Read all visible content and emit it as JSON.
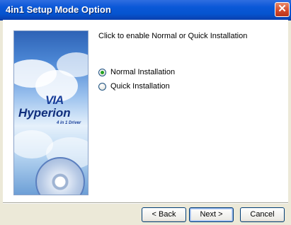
{
  "window": {
    "title": "4in1 Setup Mode Option",
    "close_glyph": "✕"
  },
  "banner": {
    "brand_mark": "VIA",
    "product_name": "Hyperion",
    "product_sub": "4 in 1 Driver"
  },
  "content": {
    "heading": "Click to enable Normal or Quick Installation",
    "options": [
      {
        "label": "Normal Installation",
        "checked": true
      },
      {
        "label": "Quick Installation",
        "checked": false
      }
    ]
  },
  "buttons": {
    "back": "< Back",
    "next": "Next >",
    "cancel": "Cancel"
  },
  "colors": {
    "title_bar": "#0554cf",
    "window_bg": "#ECE9D8",
    "close_button": "#d1482a"
  },
  "icons": {
    "close": "close-icon",
    "artwork": "hyperion-banner-image"
  }
}
